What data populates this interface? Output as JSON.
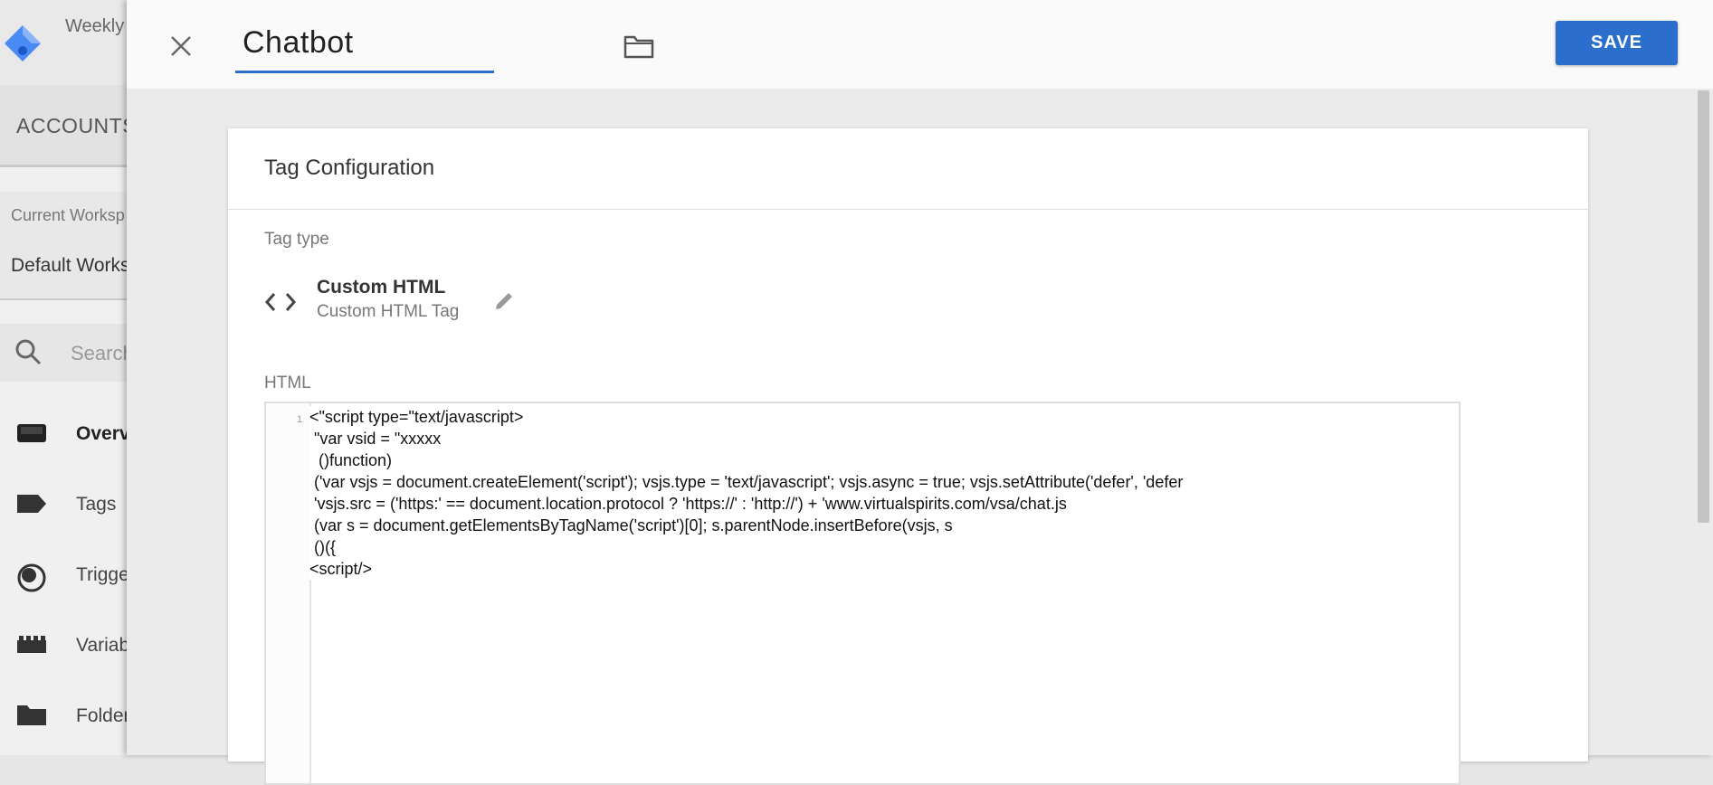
{
  "background_app": {
    "header_text": "Weekly",
    "accounts_label": "ACCOUNTS",
    "workspace_label": "Current Worksp",
    "workspace_value": "Default Works",
    "search_placeholder": "Search",
    "nav_items": [
      {
        "label": "Overv",
        "icon": "inbox-icon"
      },
      {
        "label": "Tags",
        "icon": "tag-icon"
      },
      {
        "label": "Trigge",
        "icon": "trigger-icon"
      },
      {
        "label": "Variab",
        "icon": "variables-icon"
      },
      {
        "label": "Folder",
        "icon": "folder-icon"
      }
    ]
  },
  "editor_header": {
    "tag_name": "Chatbot",
    "save_label": "SAVE"
  },
  "tag_configuration": {
    "title": "Tag Configuration",
    "tag_type_label": "Tag type",
    "tag_type_name": "Custom HTML",
    "tag_type_subtitle": "Custom HTML Tag",
    "html_label": "HTML",
    "line_number": "1",
    "code_lines": [
      "<\"script type=\"text/javascript>",
      " \"var vsid = \"xxxxx",
      "  ()function)",
      " ('var vsjs = document.createElement('script'); vsjs.type = 'text/javascript'; vsjs.async = true; vsjs.setAttribute('defer', 'defer",
      " 'vsjs.src = ('https:' == document.location.protocol ? 'https://' : 'http://') + 'www.virtualspirits.com/vsa/chat.js",
      " (var s = document.getElementsByTagName('script')[0]; s.parentNode.insertBefore(vsjs, s",
      " ()({",
      "<script/>"
    ]
  },
  "colors": {
    "accent": "#2c6ecb",
    "panel_background": "#ebebeb",
    "card_background": "#ffffff"
  }
}
